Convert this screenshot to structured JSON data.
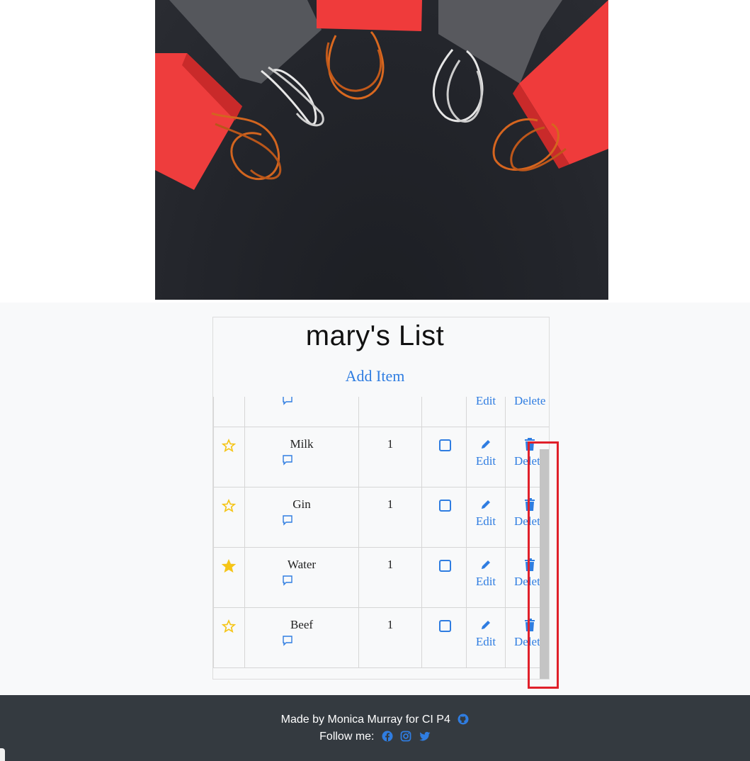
{
  "list": {
    "title": "mary's List",
    "add_item_label": "Add Item",
    "partial_row": {
      "edit_label": "Edit",
      "delete_label": "Delete"
    },
    "items": [
      {
        "name": "Milk",
        "quantity": "1",
        "favorite": false,
        "edit_label": "Edit",
        "delete_label": "Delete"
      },
      {
        "name": "Gin",
        "quantity": "1",
        "favorite": false,
        "edit_label": "Edit",
        "delete_label": "Delete"
      },
      {
        "name": "Water",
        "quantity": "1",
        "favorite": true,
        "edit_label": "Edit",
        "delete_label": "Delete"
      },
      {
        "name": "Beef",
        "quantity": "1",
        "favorite": false,
        "edit_label": "Edit",
        "delete_label": "Delete"
      }
    ]
  },
  "footer": {
    "credit": "Made by Monica Murray for CI P4",
    "follow_label": "Follow me:",
    "icons": [
      "github-icon",
      "facebook-icon",
      "instagram-icon",
      "twitter-icon"
    ]
  },
  "colors": {
    "accent": "#2f7de1",
    "star": "#f5c518",
    "footer_bg": "#343a40",
    "highlight": "#e0202a"
  }
}
